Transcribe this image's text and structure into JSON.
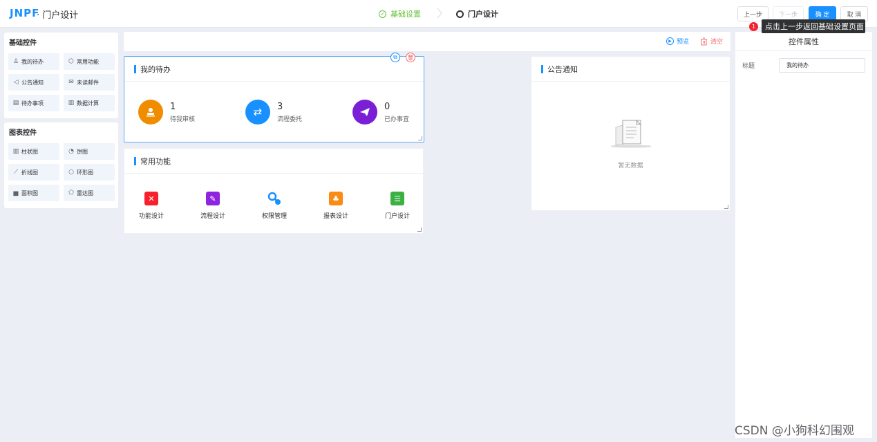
{
  "header": {
    "logo_part1": "JNPF",
    "logo_part2": "",
    "app_title": "· 门户设计",
    "steps": [
      "基础设置",
      "门户设计"
    ],
    "buttons": {
      "prev": "上一步",
      "next": "下一步",
      "ok": "确 定",
      "cancel": "取 消"
    },
    "tooltip": "点击上一步返回基础设置页面",
    "tooltip_badge": "1"
  },
  "left_panel": {
    "basic_title": "基础控件",
    "basic_items": [
      {
        "label": "我的待办",
        "icon": "user-icon"
      },
      {
        "label": "常用功能",
        "icon": "box-icon"
      },
      {
        "label": "公告通知",
        "icon": "speaker-icon"
      },
      {
        "label": "未读邮件",
        "icon": "mail-icon"
      },
      {
        "label": "待办事项",
        "icon": "calendar-icon"
      },
      {
        "label": "数据计算",
        "icon": "bar-chart-icon"
      }
    ],
    "chart_title": "图表控件",
    "chart_items": [
      {
        "label": "柱状图",
        "icon": "bar-chart-icon"
      },
      {
        "label": "饼图",
        "icon": "pie-chart-icon"
      },
      {
        "label": "折线图",
        "icon": "line-chart-icon"
      },
      {
        "label": "环形图",
        "icon": "ring-chart-icon"
      },
      {
        "label": "面积图",
        "icon": "area-chart-icon"
      },
      {
        "label": "雷达图",
        "icon": "radar-chart-icon"
      }
    ]
  },
  "toolbar": {
    "preview": "预览",
    "clear": "清空"
  },
  "todo_widget": {
    "title": "我的待办",
    "items": [
      {
        "count": "1",
        "label": "待我审核",
        "color": "#f08c00"
      },
      {
        "count": "3",
        "label": "流程委托",
        "color": "#1890ff"
      },
      {
        "count": "0",
        "label": "已办事宜",
        "color": "#7b1fd6"
      }
    ]
  },
  "common_widget": {
    "title": "常用功能",
    "items": [
      {
        "label": "功能设计",
        "color": "#f5222d"
      },
      {
        "label": "流程设计",
        "color": "#8e24e0"
      },
      {
        "label": "权限管理",
        "color": "#1890ff"
      },
      {
        "label": "报表设计",
        "color": "#fa8c16"
      },
      {
        "label": "门户设计",
        "color": "#3cb043"
      }
    ]
  },
  "notice_widget": {
    "title": "公告通知",
    "empty_text": "暂无数据"
  },
  "right_panel": {
    "title": "控件属性",
    "field_label": "标题",
    "field_value": "我的待办"
  },
  "watermark": "CSDN @小狗科幻围观"
}
